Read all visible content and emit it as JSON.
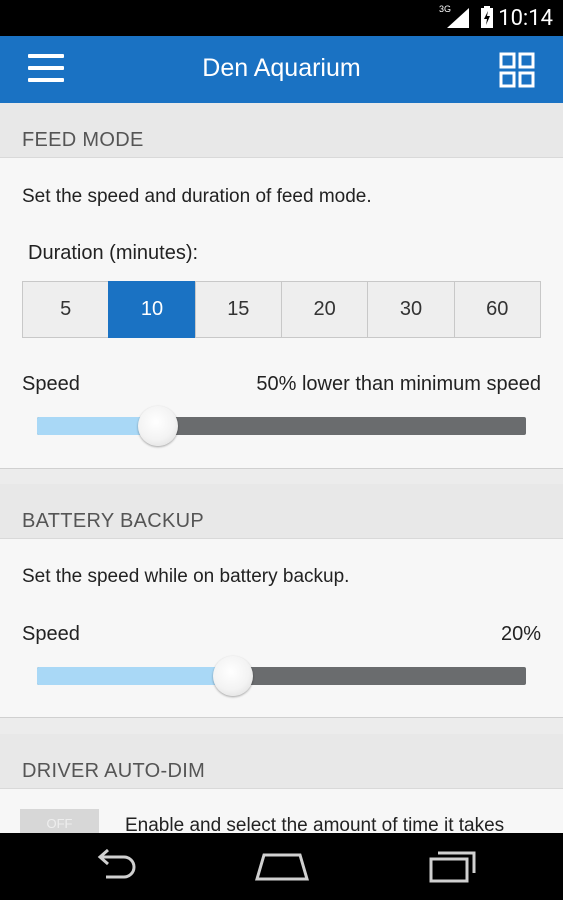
{
  "status_bar": {
    "network": "3G",
    "time": "10:14"
  },
  "app_bar": {
    "title": "Den Aquarium",
    "menu_icon": "hamburger-menu-icon",
    "grid_icon": "grid-view-icon"
  },
  "feed_mode": {
    "header": "FEED MODE",
    "description": "Set the speed and duration of feed mode.",
    "duration_label": "Duration (minutes):",
    "durations": [
      "5",
      "10",
      "15",
      "20",
      "30",
      "60"
    ],
    "selected_duration": "10",
    "speed_label": "Speed",
    "speed_value": "50% lower than minimum speed",
    "speed_slider_fraction": 0.247
  },
  "battery_backup": {
    "header": "BATTERY BACKUP",
    "description": "Set the speed while on battery backup.",
    "speed_label": "Speed",
    "speed_value": "20%",
    "speed_slider_fraction": 0.4
  },
  "driver_auto_dim": {
    "header": "DRIVER AUTO-DIM",
    "toggle_label": "OFF",
    "description": "Enable and select the amount of time it takes"
  },
  "colors": {
    "accent": "#1a72c3",
    "slider_fill": "#a9d8f6",
    "slider_track": "#6a6c6e"
  }
}
